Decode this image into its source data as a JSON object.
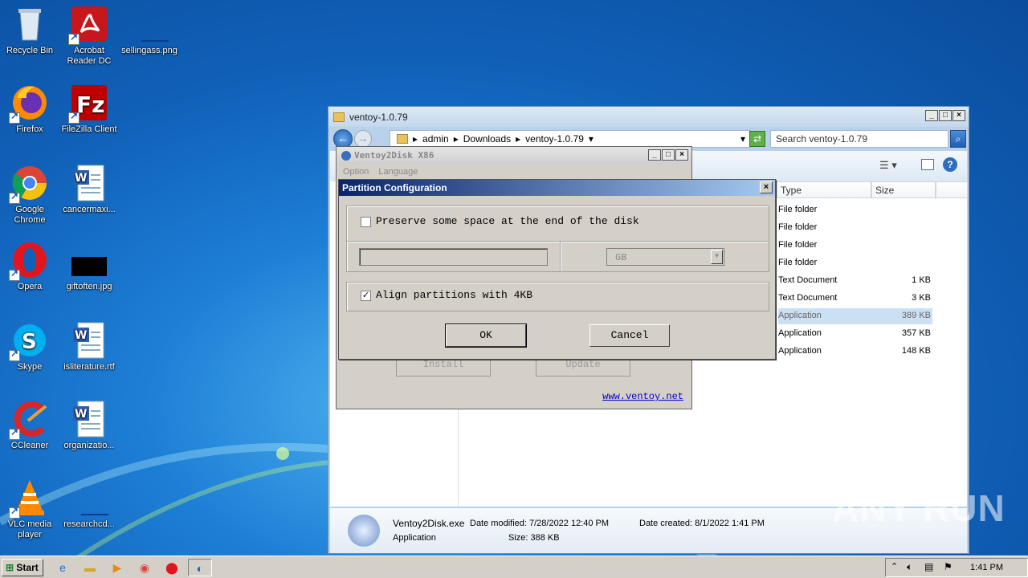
{
  "desktop": {
    "icons": [
      {
        "label": "Recycle Bin"
      },
      {
        "label": "Acrobat Reader DC"
      },
      {
        "label": "sellingass.png"
      },
      {
        "label": "Firefox"
      },
      {
        "label": "FileZilla Client"
      },
      {
        "label": "Google Chrome"
      },
      {
        "label": "cancermaxi..."
      },
      {
        "label": "Opera"
      },
      {
        "label": "giftoften.jpg"
      },
      {
        "label": "Skype"
      },
      {
        "label": "isliterature.rtf"
      },
      {
        "label": "CCleaner"
      },
      {
        "label": "organizatio..."
      },
      {
        "label": "VLC media player"
      },
      {
        "label": "researchcd..."
      }
    ]
  },
  "explorer": {
    "title": "ventoy-1.0.79",
    "breadcrumb": [
      "admin",
      "Downloads",
      "ventoy-1.0.79"
    ],
    "search_placeholder": "Search ventoy-1.0.79",
    "columns": {
      "type": "Type",
      "size": "Size"
    },
    "rows": [
      {
        "type": "File folder",
        "size": ""
      },
      {
        "type": "File folder",
        "size": ""
      },
      {
        "type": "File folder",
        "size": ""
      },
      {
        "type": "File folder",
        "size": ""
      },
      {
        "type": "Text Document",
        "size": "1 KB"
      },
      {
        "type": "Text Document",
        "size": "3 KB"
      },
      {
        "type": "Application",
        "size": "389 KB"
      },
      {
        "type": "Application",
        "size": "357 KB"
      },
      {
        "type": "Application",
        "size": "148 KB"
      }
    ],
    "details": {
      "name": "Ventoy2Disk.exe",
      "modified": "Date modified: 7/28/2022 12:40 PM",
      "created": "Date created: 8/1/2022 1:41 PM",
      "kind": "Application",
      "size": "Size: 388 KB"
    }
  },
  "ventoy": {
    "title": "Ventoy2Disk  X86",
    "menu": [
      "Option",
      "Language"
    ],
    "install_label": "Install",
    "update_label": "Update",
    "link": "www.ventoy.net"
  },
  "dialog": {
    "title": "Partition Configuration",
    "preserve_label": "Preserve some space at the end of the disk",
    "preserve_checked": false,
    "size_value": "",
    "unit_value": "GB",
    "align_label": "Align partitions with 4KB",
    "align_checked": true,
    "ok_label": "OK",
    "cancel_label": "Cancel"
  },
  "taskbar": {
    "start_label": "Start",
    "clock": "1:41 PM"
  },
  "watermark": "ANY RUN"
}
